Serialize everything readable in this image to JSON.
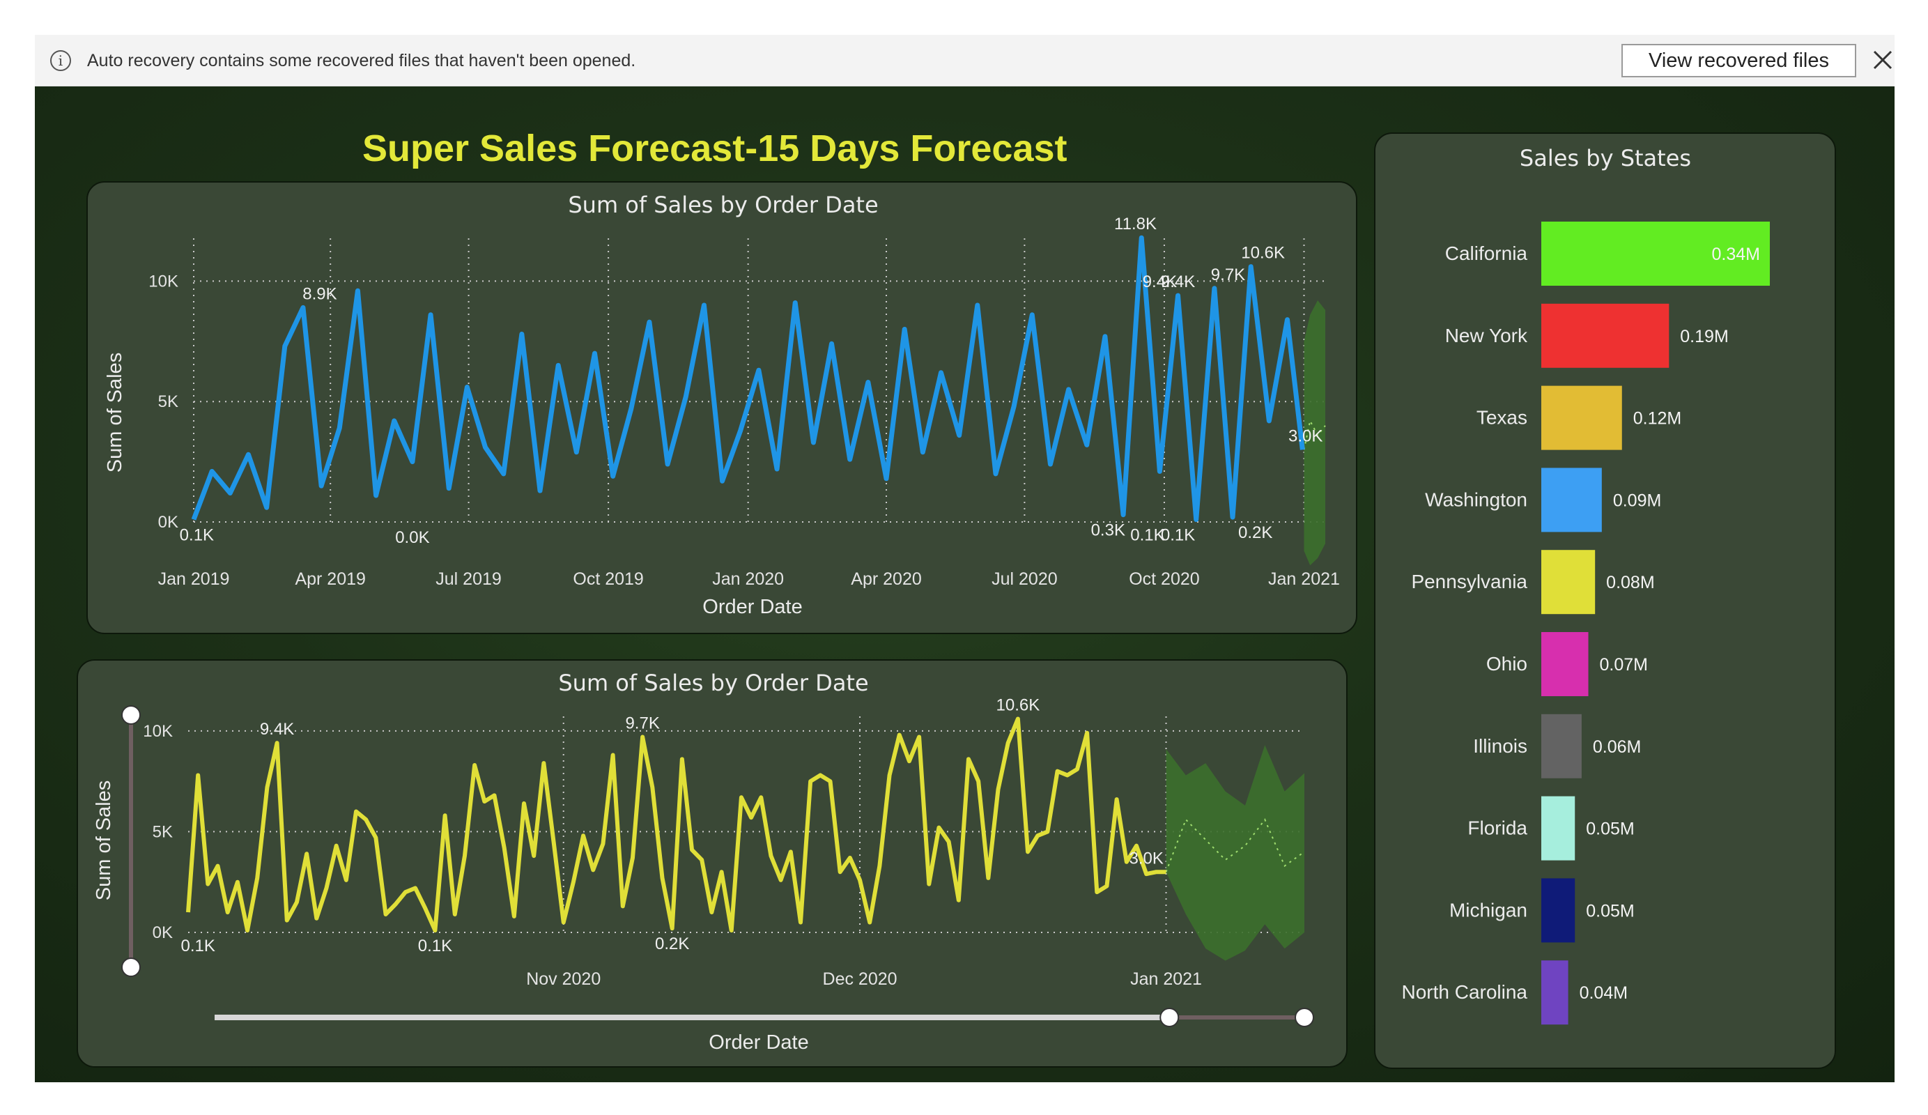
{
  "notification": {
    "message": "Auto recovery contains some recovered files that haven't been opened.",
    "view_button_label": "View recovered files",
    "icons": {
      "info": "info-icon",
      "close": "close-icon"
    }
  },
  "dashboard": {
    "title": "Super Sales Forecast-15 Days Forecast"
  },
  "colors": {
    "background": "#1c3017",
    "panel": "#3a4836",
    "title": "#e3e839",
    "line_top": "#1f95e6",
    "line_bottom": "#e0df38",
    "forecast_band": "#3c6f2c"
  },
  "chart_data": [
    {
      "type": "line",
      "title": "Sum of Sales by Order Date",
      "xlabel": "Order Date",
      "ylabel": "Sum of Sales",
      "x_ticks": [
        "Jan 2019",
        "Apr 2019",
        "Jul 2019",
        "Oct 2019",
        "Jan 2020",
        "Apr 2020",
        "Jul 2020",
        "Oct 2020",
        "Jan 2021"
      ],
      "y_ticks": [
        "0K",
        "5K",
        "10K"
      ],
      "ylim": [
        0,
        12500
      ],
      "xlim": [
        "2019-01-01",
        "2021-01-15"
      ],
      "grid": true,
      "series": [
        {
          "color": "#1f95e6",
          "x": [
            "2019-01-01",
            "2019-01-13",
            "2019-01-25",
            "2019-02-06",
            "2019-02-18",
            "2019-03-02",
            "2019-03-14",
            "2019-03-26",
            "2019-04-07",
            "2019-04-19",
            "2019-05-01",
            "2019-05-13",
            "2019-05-25",
            "2019-06-06",
            "2019-06-18",
            "2019-06-30",
            "2019-07-12",
            "2019-07-24",
            "2019-08-05",
            "2019-08-17",
            "2019-08-29",
            "2019-09-10",
            "2019-09-22",
            "2019-10-04",
            "2019-10-16",
            "2019-10-28",
            "2019-11-09",
            "2019-11-21",
            "2019-12-03",
            "2019-12-15",
            "2019-12-27",
            "2020-01-08",
            "2020-01-20",
            "2020-02-01",
            "2020-02-13",
            "2020-02-25",
            "2020-03-08",
            "2020-03-20",
            "2020-04-01",
            "2020-04-13",
            "2020-04-25",
            "2020-05-07",
            "2020-05-19",
            "2020-05-31",
            "2020-06-12",
            "2020-06-24",
            "2020-07-06",
            "2020-07-18",
            "2020-07-30",
            "2020-08-11",
            "2020-08-23",
            "2020-09-04",
            "2020-09-16",
            "2020-09-28",
            "2020-10-10",
            "2020-10-22",
            "2020-11-03",
            "2020-11-15",
            "2020-11-27",
            "2020-12-09",
            "2020-12-21",
            "2020-12-31"
          ],
          "y": [
            100,
            2100,
            1200,
            2800,
            600,
            7300,
            8900,
            1500,
            3900,
            9600,
            1100,
            4200,
            2500,
            8600,
            1400,
            5600,
            3100,
            2000,
            7800,
            1300,
            6500,
            2900,
            7000,
            1900,
            4700,
            8300,
            2400,
            5200,
            9000,
            1700,
            3800,
            6300,
            2200,
            9100,
            3300,
            7400,
            2600,
            5800,
            1800,
            8000,
            2900,
            6200,
            3600,
            9000,
            2000,
            4800,
            8600,
            2400,
            5500,
            3200,
            7700,
            300,
            11800,
            2100,
            9400,
            100,
            9700,
            200,
            10600,
            4200,
            8400,
            3000
          ]
        },
        {
          "name": "Forecast",
          "color": "#3c6f2c",
          "x": [
            "2021-01-01",
            "2021-01-05",
            "2021-01-10",
            "2021-01-15"
          ],
          "y": [
            3000,
            4200,
            3600,
            4000
          ],
          "lower": [
            -1200,
            -1800,
            -1500,
            -900
          ],
          "upper": [
            7500,
            8600,
            9200,
            8800
          ]
        }
      ],
      "annotations": [
        {
          "x": "2019-01-03",
          "y": 100,
          "text": "0.1K"
        },
        {
          "x": "2019-03-25",
          "y": 8900,
          "text": "8.9K"
        },
        {
          "x": "2019-05-25",
          "y": 0,
          "text": "0.0K"
        },
        {
          "x": "2020-08-25",
          "y": 300,
          "text": "0.3K"
        },
        {
          "x": "2020-09-12",
          "y": 11800,
          "text": "11.8K"
        },
        {
          "x": "2020-09-20",
          "y": 100,
          "text": "0.1K"
        },
        {
          "x": "2020-09-28",
          "y": 9400,
          "text": "9.4K"
        },
        {
          "x": "2020-10-10",
          "y": 9400,
          "text": "9.4K"
        },
        {
          "x": "2020-10-10",
          "y": 100,
          "text": "0.1K"
        },
        {
          "x": "2020-11-12",
          "y": 9700,
          "text": "9.7K"
        },
        {
          "x": "2020-11-30",
          "y": 200,
          "text": "0.2K"
        },
        {
          "x": "2020-12-05",
          "y": 10600,
          "text": "10.6K"
        },
        {
          "x": "2021-01-02",
          "y": 3000,
          "text": "3.0K"
        }
      ]
    },
    {
      "type": "line",
      "title": "Sum of Sales by Order Date",
      "xlabel": "Order Date",
      "ylabel": "Sum of Sales",
      "x_ticks": [
        "Nov 2020",
        "Dec 2020",
        "Jan 2021"
      ],
      "y_ticks": [
        "0K",
        "5K",
        "10K"
      ],
      "ylim": [
        0,
        12000
      ],
      "xlim": [
        "2020-09-24",
        "2021-01-15"
      ],
      "grid": true,
      "series": [
        {
          "color": "#e0df38",
          "x": [
            "2020-09-24",
            "2020-09-25",
            "2020-09-26",
            "2020-09-27",
            "2020-09-28",
            "2020-09-29",
            "2020-09-30",
            "2020-10-01",
            "2020-10-02",
            "2020-10-03",
            "2020-10-04",
            "2020-10-05",
            "2020-10-06",
            "2020-10-07",
            "2020-10-08",
            "2020-10-09",
            "2020-10-10",
            "2020-10-11",
            "2020-10-12",
            "2020-10-13",
            "2020-10-14",
            "2020-10-15",
            "2020-10-16",
            "2020-10-17",
            "2020-10-18",
            "2020-10-19",
            "2020-10-20",
            "2020-10-21",
            "2020-10-22",
            "2020-10-23",
            "2020-10-24",
            "2020-10-25",
            "2020-10-26",
            "2020-10-27",
            "2020-10-28",
            "2020-10-29",
            "2020-10-30",
            "2020-10-31",
            "2020-11-01",
            "2020-11-02",
            "2020-11-03",
            "2020-11-04",
            "2020-11-05",
            "2020-11-06",
            "2020-11-07",
            "2020-11-08",
            "2020-11-09",
            "2020-11-10",
            "2020-11-11",
            "2020-11-12",
            "2020-11-13",
            "2020-11-14",
            "2020-11-15",
            "2020-11-16",
            "2020-11-17",
            "2020-11-18",
            "2020-11-19",
            "2020-11-20",
            "2020-11-21",
            "2020-11-22",
            "2020-11-23",
            "2020-11-24",
            "2020-11-25",
            "2020-11-26",
            "2020-11-27",
            "2020-11-28",
            "2020-11-29",
            "2020-11-30",
            "2020-12-01",
            "2020-12-02",
            "2020-12-03",
            "2020-12-04",
            "2020-12-05",
            "2020-12-06",
            "2020-12-07",
            "2020-12-08",
            "2020-12-09",
            "2020-12-10",
            "2020-12-11",
            "2020-12-12",
            "2020-12-13",
            "2020-12-14",
            "2020-12-15",
            "2020-12-16",
            "2020-12-17",
            "2020-12-18",
            "2020-12-19",
            "2020-12-20",
            "2020-12-21",
            "2020-12-22",
            "2020-12-23",
            "2020-12-24",
            "2020-12-25",
            "2020-12-26",
            "2020-12-27",
            "2020-12-28",
            "2020-12-29",
            "2020-12-30",
            "2020-12-31",
            "2021-01-01"
          ],
          "y": [
            1000,
            7800,
            2400,
            3300,
            1000,
            2500,
            100,
            2700,
            7200,
            9400,
            600,
            1500,
            3900,
            700,
            2200,
            4300,
            2600,
            6000,
            5600,
            4700,
            900,
            1400,
            2000,
            2200,
            1200,
            100,
            5800,
            900,
            3800,
            8300,
            6500,
            6800,
            4200,
            800,
            6400,
            3800,
            8400,
            4500,
            500,
            2500,
            4800,
            3100,
            4400,
            8800,
            1300,
            3700,
            9700,
            7200,
            2700,
            200,
            8600,
            4100,
            3600,
            1000,
            3000,
            100,
            6700,
            5700,
            6700,
            3800,
            2600,
            4000,
            500,
            7500,
            7800,
            7500,
            3000,
            3700,
            2600,
            500,
            3300,
            7800,
            9800,
            8500,
            9700,
            2400,
            5200,
            4500,
            1600,
            8600,
            7500,
            2700,
            7100,
            9400,
            10600,
            4000,
            4800,
            5000,
            8000,
            7800,
            8100,
            9900,
            2000,
            2300,
            6600,
            3500,
            4300,
            2900,
            3000,
            3000
          ]
        },
        {
          "name": "Forecast",
          "color": "#3c6f2c",
          "x": [
            "2021-01-01",
            "2021-01-03",
            "2021-01-05",
            "2021-01-07",
            "2021-01-09",
            "2021-01-11",
            "2021-01-13",
            "2021-01-15"
          ],
          "y": [
            3000,
            5600,
            4600,
            3600,
            4300,
            5600,
            3300,
            4000
          ],
          "lower": [
            3000,
            900,
            -800,
            -1400,
            -900,
            400,
            -800,
            0
          ],
          "upper": [
            9100,
            7800,
            8400,
            7000,
            6300,
            9300,
            7000,
            7900
          ]
        }
      ],
      "annotations": [
        {
          "x": "2020-09-25",
          "y": 100,
          "text": "0.1K"
        },
        {
          "x": "2020-10-03",
          "y": 9400,
          "text": "9.4K"
        },
        {
          "x": "2020-10-19",
          "y": 100,
          "text": "0.1K"
        },
        {
          "x": "2020-11-09",
          "y": 9700,
          "text": "9.7K"
        },
        {
          "x": "2020-11-12",
          "y": 200,
          "text": "0.2K"
        },
        {
          "x": "2020-12-17",
          "y": 10600,
          "text": "10.6K"
        },
        {
          "x": "2020-12-30",
          "y": 3000,
          "text": "3.0K"
        }
      ],
      "x_range_slider": {
        "start": "2020-09-24",
        "end": "2021-01-01",
        "max": "2021-01-15"
      }
    },
    {
      "type": "bar",
      "orientation": "horizontal",
      "title": "Sales by States",
      "categories": [
        "California",
        "New York",
        "Texas",
        "Washington",
        "Pennsylvania",
        "Ohio",
        "Illinois",
        "Florida",
        "Michigan",
        "North Carolina"
      ],
      "values": [
        0.34,
        0.19,
        0.12,
        0.09,
        0.08,
        0.07,
        0.06,
        0.05,
        0.05,
        0.04
      ],
      "labels": [
        "0.34M",
        "0.19M",
        "0.12M",
        "0.09M",
        "0.08M",
        "0.07M",
        "0.06M",
        "0.05M",
        "0.05M",
        "0.04M"
      ],
      "unit": "M",
      "colors": [
        "#62ec22",
        "#ee3131",
        "#e2bc34",
        "#3d9ff3",
        "#e0df38",
        "#d72fae",
        "#636363",
        "#a6eedd",
        "#0f1b78",
        "#6f44c1"
      ]
    }
  ]
}
